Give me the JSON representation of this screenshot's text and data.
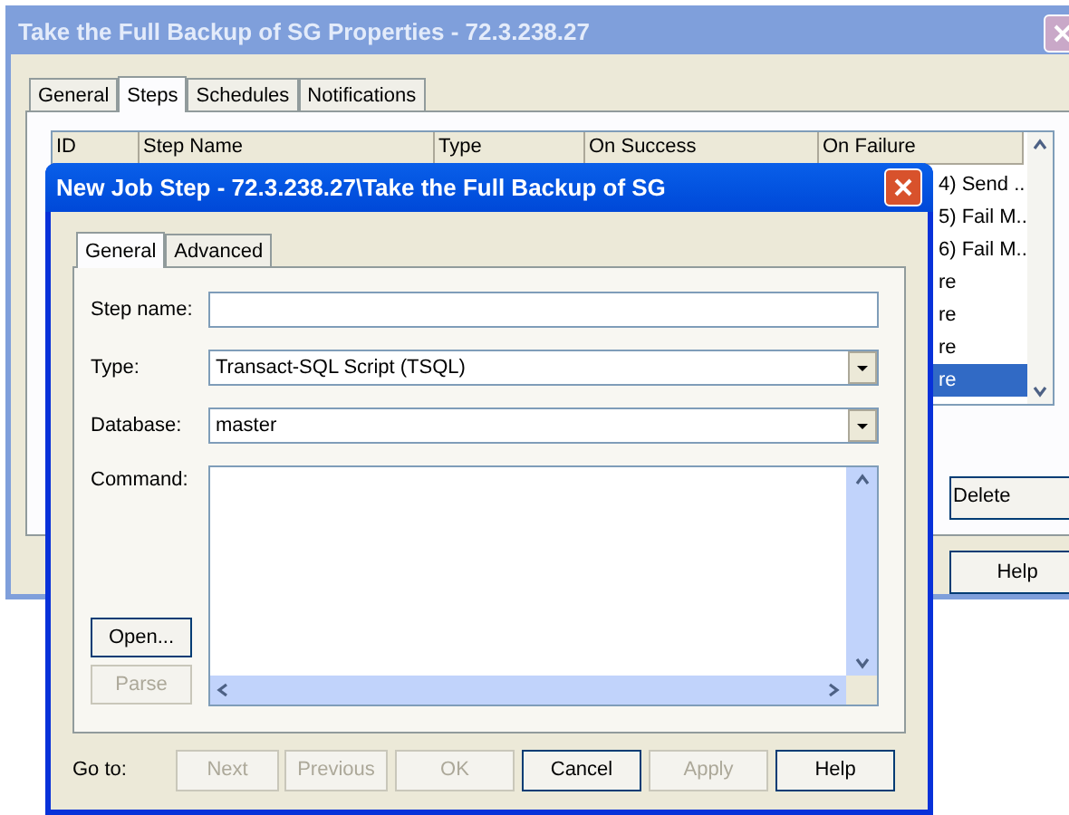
{
  "background_window": {
    "title": "Take the Full Backup of SG Properties - 72.3.238.27",
    "tabs": [
      {
        "label": "General",
        "selected": false
      },
      {
        "label": "Steps",
        "selected": true
      },
      {
        "label": "Schedules",
        "selected": false
      },
      {
        "label": "Notifications",
        "selected": false
      }
    ],
    "list": {
      "columns": [
        "ID",
        "Step Name",
        "Type",
        "On Success",
        "On Failure"
      ],
      "rows": [
        {
          "on_failure": "4) Send ..",
          "selected": false
        },
        {
          "on_failure": "5) Fail M..",
          "selected": false
        },
        {
          "on_failure": "6) Fail M..",
          "selected": false
        },
        {
          "on_failure": "re",
          "selected": false
        },
        {
          "on_failure": "re",
          "selected": false
        },
        {
          "on_failure": "re",
          "selected": false
        },
        {
          "on_failure": "re",
          "selected": true
        }
      ]
    },
    "buttons": [
      {
        "label": "Delete",
        "kind": "partial"
      },
      {
        "label": "Help",
        "kind": "full"
      }
    ]
  },
  "dialog": {
    "title": "New Job Step - 72.3.238.27\\Take the Full Backup of SG",
    "tabs": [
      {
        "label": "General",
        "selected": true
      },
      {
        "label": "Advanced",
        "selected": false
      }
    ],
    "fields": [
      {
        "label": "Step name:",
        "kind": "text"
      },
      {
        "label": "Type:",
        "kind": "select",
        "value": "Transact-SQL Script (TSQL)"
      },
      {
        "label": "Database:",
        "kind": "select",
        "value": "master"
      }
    ],
    "command": {
      "label": "Command:",
      "buttons": [
        {
          "label": "Open...",
          "disabled": false
        },
        {
          "label": "Parse",
          "disabled": true
        }
      ]
    },
    "goto_label": "Go to:",
    "buttons": [
      {
        "label": "Next",
        "disabled": true
      },
      {
        "label": "Previous",
        "disabled": true
      },
      {
        "label": "OK",
        "disabled": true
      },
      {
        "label": "Cancel",
        "disabled": false
      },
      {
        "label": "Apply",
        "disabled": true
      },
      {
        "label": "Help",
        "disabled": false
      }
    ]
  }
}
